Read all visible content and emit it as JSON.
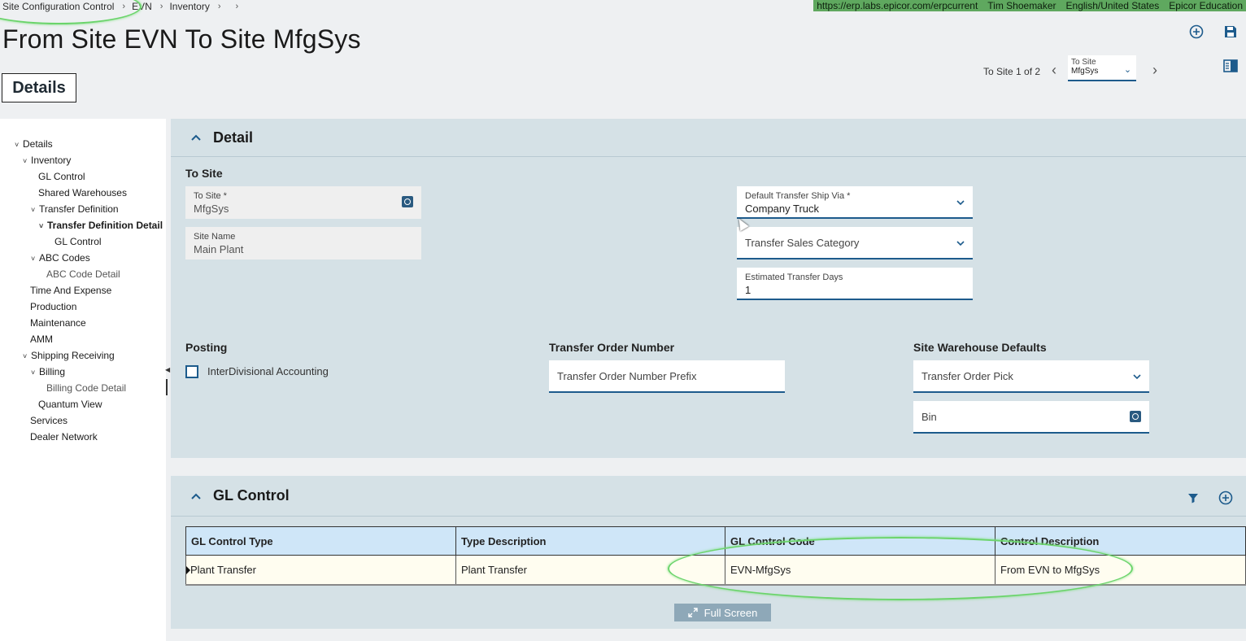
{
  "breadcrumb": {
    "items": [
      "Site Configuration Control",
      "EVN",
      "Inventory",
      ""
    ]
  },
  "sysinfo": {
    "url": "https://erp.labs.epicor.com/erpcurrent",
    "user": "Tim Shoemaker",
    "locale": "English/United States",
    "company": "Epicor Education"
  },
  "page": {
    "title": "From Site EVN To Site MfgSys",
    "tab_label": "Details"
  },
  "pager": {
    "label": "To Site 1 of 2",
    "select_label": "To Site",
    "select_value": "MfgSys"
  },
  "tree": [
    {
      "label": "Details",
      "twisty": "˅"
    },
    {
      "label": "Inventory",
      "twisty": "˅"
    },
    {
      "label": "GL Control",
      "twisty": ""
    },
    {
      "label": "Shared Warehouses",
      "twisty": ""
    },
    {
      "label": "Transfer Definition",
      "twisty": "˅"
    },
    {
      "label": "Transfer Definition Detail",
      "twisty": "˅"
    },
    {
      "label": "GL Control",
      "twisty": ""
    },
    {
      "label": "ABC Codes",
      "twisty": "˅"
    },
    {
      "label": "ABC Code Detail",
      "twisty": ""
    },
    {
      "label": "Time And Expense",
      "twisty": ""
    },
    {
      "label": "Production",
      "twisty": ""
    },
    {
      "label": "Maintenance",
      "twisty": ""
    },
    {
      "label": "AMM",
      "twisty": ""
    },
    {
      "label": "Shipping Receiving",
      "twisty": "˅"
    },
    {
      "label": "Billing",
      "twisty": "˅"
    },
    {
      "label": "Billing Code Detail",
      "twisty": ""
    },
    {
      "label": "Quantum View",
      "twisty": ""
    },
    {
      "label": "Services",
      "twisty": ""
    },
    {
      "label": "Dealer Network",
      "twisty": ""
    }
  ],
  "detail": {
    "header": "Detail",
    "to_site_section": "To Site",
    "to_site": {
      "label": "To Site *",
      "value": "MfgSys"
    },
    "site_name": {
      "label": "Site Name",
      "value": "Main Plant"
    },
    "ship_via": {
      "label": "Default Transfer Ship Via *",
      "value": "Company Truck"
    },
    "sales_category": {
      "placeholder": "Transfer Sales Category"
    },
    "est_days": {
      "label": "Estimated Transfer Days",
      "value": "1"
    },
    "posting_section": "Posting",
    "interdivisional": {
      "label": "InterDivisional Accounting",
      "checked": false
    },
    "order_number_section": "Transfer Order Number",
    "order_prefix": {
      "placeholder": "Transfer Order Number Prefix"
    },
    "warehouse_section": "Site Warehouse Defaults",
    "order_pick": {
      "placeholder": "Transfer Order Pick"
    },
    "bin": {
      "placeholder": "Bin"
    }
  },
  "gl": {
    "header": "GL Control",
    "columns": [
      "GL Control Type",
      "Type Description",
      "GL Control Code",
      "Control Description"
    ],
    "rows": [
      [
        "Plant Transfer",
        "Plant Transfer",
        "EVN-MfgSys",
        "From EVN to MfgSys"
      ]
    ],
    "fullscreen_label": "Full Screen"
  },
  "colors": {
    "accent": "#1d5b8c",
    "panel": "#d5e1e6",
    "header_cell": "#cfe6f8",
    "annotation": "#6bd46b",
    "sysinfo_bg": "#5fa85f"
  }
}
